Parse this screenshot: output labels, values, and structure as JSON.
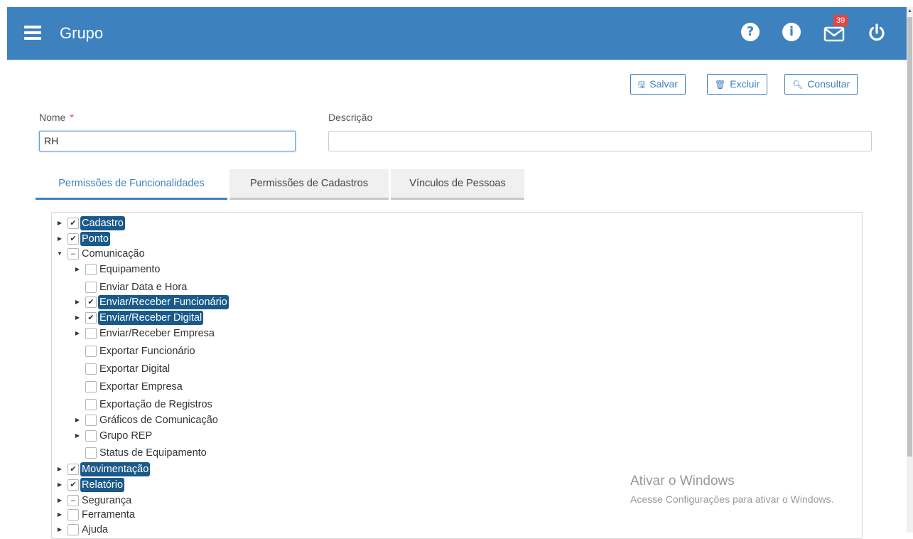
{
  "header": {
    "title": "Grupo",
    "notification_count": "39",
    "icons": [
      "menu-icon",
      "help-icon",
      "info-icon",
      "mail-icon",
      "power-icon"
    ],
    "color": "#3d82bf"
  },
  "toolbar": {
    "save_label": "Salvar",
    "delete_label": "Excluir",
    "search_label": "Consultar"
  },
  "form": {
    "name_label": "Nome",
    "name_required_mark": "*",
    "name_value": "RH",
    "description_label": "Descrição",
    "description_value": ""
  },
  "tabs": [
    {
      "label": "Permissões de Funcionalidades",
      "active": true
    },
    {
      "label": "Permissões de Cadastros",
      "active": false
    },
    {
      "label": "Vínculos de Pessoas",
      "active": false
    }
  ],
  "tree": [
    {
      "label": "Cadastro",
      "state": "checked",
      "expander": "collapsed",
      "selected": true,
      "level": 0
    },
    {
      "label": "Ponto",
      "state": "checked",
      "expander": "collapsed",
      "selected": true,
      "level": 0
    },
    {
      "label": "Comunicação",
      "state": "partial",
      "expander": "expanded",
      "selected": false,
      "level": 0
    },
    {
      "label": "Equipamento",
      "state": "unchecked",
      "expander": "collapsed",
      "selected": false,
      "level": 1
    },
    {
      "label": "Enviar Data e Hora",
      "state": "unchecked",
      "expander": "none",
      "selected": false,
      "level": 1
    },
    {
      "label": "Enviar/Receber Funcionário",
      "state": "checked",
      "expander": "collapsed",
      "selected": true,
      "level": 1
    },
    {
      "label": "Enviar/Receber Digital",
      "state": "checked",
      "expander": "collapsed",
      "selected": true,
      "level": 1
    },
    {
      "label": "Enviar/Receber Empresa",
      "state": "unchecked",
      "expander": "collapsed",
      "selected": false,
      "level": 1
    },
    {
      "label": "Exportar Funcionário",
      "state": "unchecked",
      "expander": "none",
      "selected": false,
      "level": 1
    },
    {
      "label": "Exportar Digital",
      "state": "unchecked",
      "expander": "none",
      "selected": false,
      "level": 1
    },
    {
      "label": "Exportar Empresa",
      "state": "unchecked",
      "expander": "none",
      "selected": false,
      "level": 1
    },
    {
      "label": "Exportação de Registros",
      "state": "unchecked",
      "expander": "none",
      "selected": false,
      "level": 1
    },
    {
      "label": "Gráficos de Comunicação",
      "state": "unchecked",
      "expander": "collapsed",
      "selected": false,
      "level": 1
    },
    {
      "label": "Grupo REP",
      "state": "unchecked",
      "expander": "collapsed",
      "selected": false,
      "level": 1
    },
    {
      "label": "Status de Equipamento",
      "state": "unchecked",
      "expander": "none",
      "selected": false,
      "level": 1
    },
    {
      "label": "Movimentação",
      "state": "checked",
      "expander": "collapsed",
      "selected": true,
      "level": 0
    },
    {
      "label": "Relatório",
      "state": "checked",
      "expander": "collapsed",
      "selected": true,
      "level": 0
    },
    {
      "label": "Segurança",
      "state": "partial",
      "expander": "collapsed",
      "selected": false,
      "level": 0
    },
    {
      "label": "Ferramenta",
      "state": "unchecked",
      "expander": "collapsed",
      "selected": false,
      "level": 0
    },
    {
      "label": "Ajuda",
      "state": "unchecked",
      "expander": "collapsed",
      "selected": false,
      "level": 0
    }
  ],
  "watermark": {
    "line1": "Ativar o Windows",
    "line2": "Acesse Configurações para ativar o Windows."
  }
}
